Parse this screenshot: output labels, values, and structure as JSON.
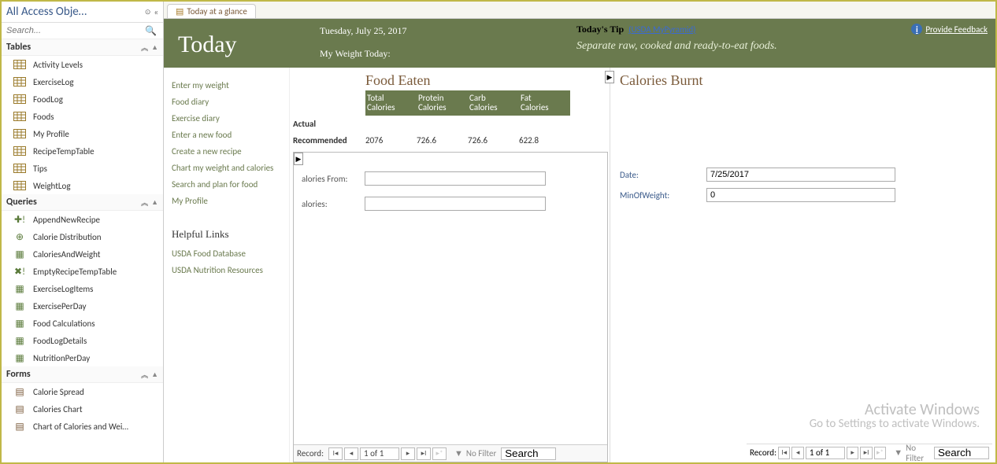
{
  "navPane": {
    "title": "All Access Obje…",
    "searchPlaceholder": "Search...",
    "groups": {
      "tables": {
        "label": "Tables",
        "items": [
          "Activity Levels",
          "ExerciseLog",
          "FoodLog",
          "Foods",
          "My Profile",
          "RecipeTempTable",
          "Tips",
          "WeightLog"
        ]
      },
      "queries": {
        "label": "Queries",
        "items": [
          "AppendNewRecipe",
          "Calorie Distribution",
          "CaloriesAndWeight",
          "EmptyRecipeTempTable",
          "ExerciseLogItems",
          "ExercisePerDay",
          "Food Calculations",
          "FoodLogDetails",
          "NutritionPerDay"
        ]
      },
      "forms": {
        "label": "Forms",
        "items": [
          "Calorie Spread",
          "Calories Chart",
          "Chart of Calories and Wei…"
        ]
      }
    }
  },
  "tab": {
    "label": "Today at a glance"
  },
  "header": {
    "todayBig": "Today",
    "date": "Tuesday, July 25, 2017",
    "weightLabel": "My Weight Today:",
    "tipLabel": "Today's Tip",
    "tipLink": "(USDA  MyPyramid)",
    "tipText": "Separate raw, cooked and ready-to-eat foods.",
    "feedback": "Provide Feedback"
  },
  "leftLinks": {
    "actions": [
      "Enter my weight",
      "Food diary",
      "Exercise diary",
      "Enter a new food",
      "Create a new recipe",
      "Chart my weight and calories",
      "Search and plan for food",
      "My Profile"
    ],
    "helpfulLabel": "Helpful Links",
    "helpful": [
      "USDA Food Database",
      "USDA Nutrition Resources"
    ]
  },
  "foodEaten": {
    "title": "Food Eaten",
    "cols": [
      [
        "Total",
        "Calories"
      ],
      [
        "Protein",
        "Calories"
      ],
      [
        "Carb",
        "Calories"
      ],
      [
        "Fat",
        "Calories"
      ]
    ],
    "actualLabel": "Actual",
    "recLabel": "Recommended",
    "recVals": [
      "2076",
      "726.6",
      "726.6",
      "622.8"
    ],
    "fields": {
      "from": "alories From:",
      "cals": "alories:"
    }
  },
  "caloriesBurnt": {
    "title": "Calories Burnt",
    "dateLabel": "Date:",
    "dateVal": "7/25/2017",
    "minLabel": "MinOfWeight:",
    "minVal": "0"
  },
  "recordNav": {
    "label": "Record:",
    "pos": "1 of 1",
    "noFilter": "No Filter",
    "search": "Search"
  },
  "watermark": {
    "line1": "Activate Windows",
    "line2": "Go to Settings to activate Windows."
  }
}
